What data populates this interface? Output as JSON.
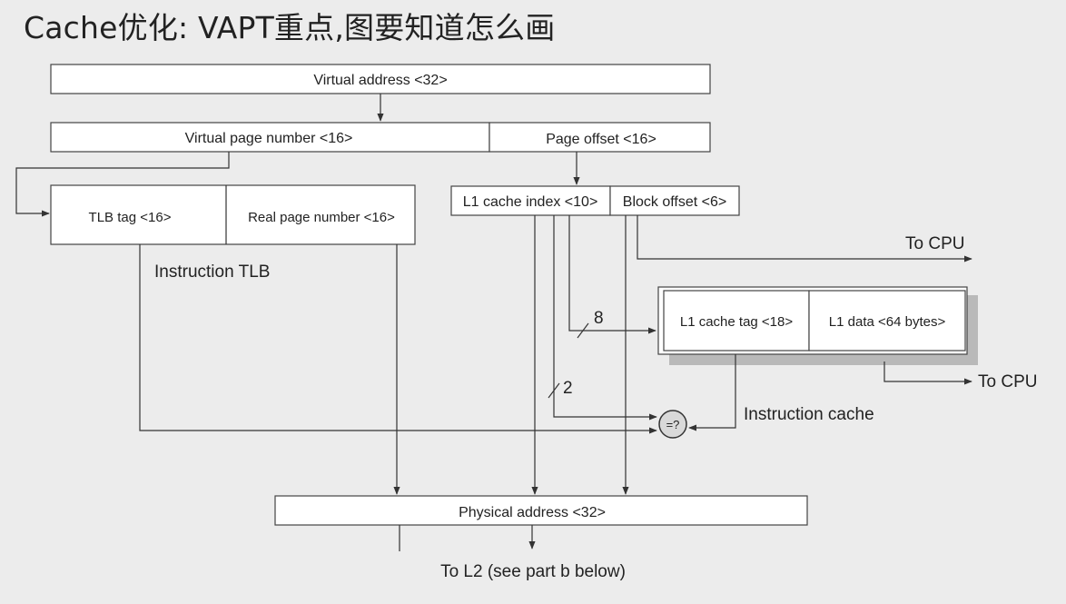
{
  "slide": {
    "title": "Cache优化: VAPT重点,图要知道怎么画"
  },
  "diagram": {
    "virtual_address": "Virtual address <32>",
    "virtual_page_number": "Virtual page number <16>",
    "page_offset": "Page offset <16>",
    "tlb_tag": "TLB tag  <16>",
    "real_page_number": "Real page number <16>",
    "instruction_tlb": "Instruction TLB",
    "l1_cache_index": "L1 cache index <10>",
    "block_offset": "Block offset <6>",
    "l1_cache_tag": "L1 cache tag <18>",
    "l1_data": "L1 data <64 bytes>",
    "instruction_cache": "Instruction cache",
    "to_cpu_top": "To CPU",
    "to_cpu_bottom": "To CPU",
    "bus_width_8": "8",
    "bus_width_2": "2",
    "comparator": "=?",
    "physical_address": "Physical address <32>",
    "to_l2": "To L2 (see part b below)"
  }
}
